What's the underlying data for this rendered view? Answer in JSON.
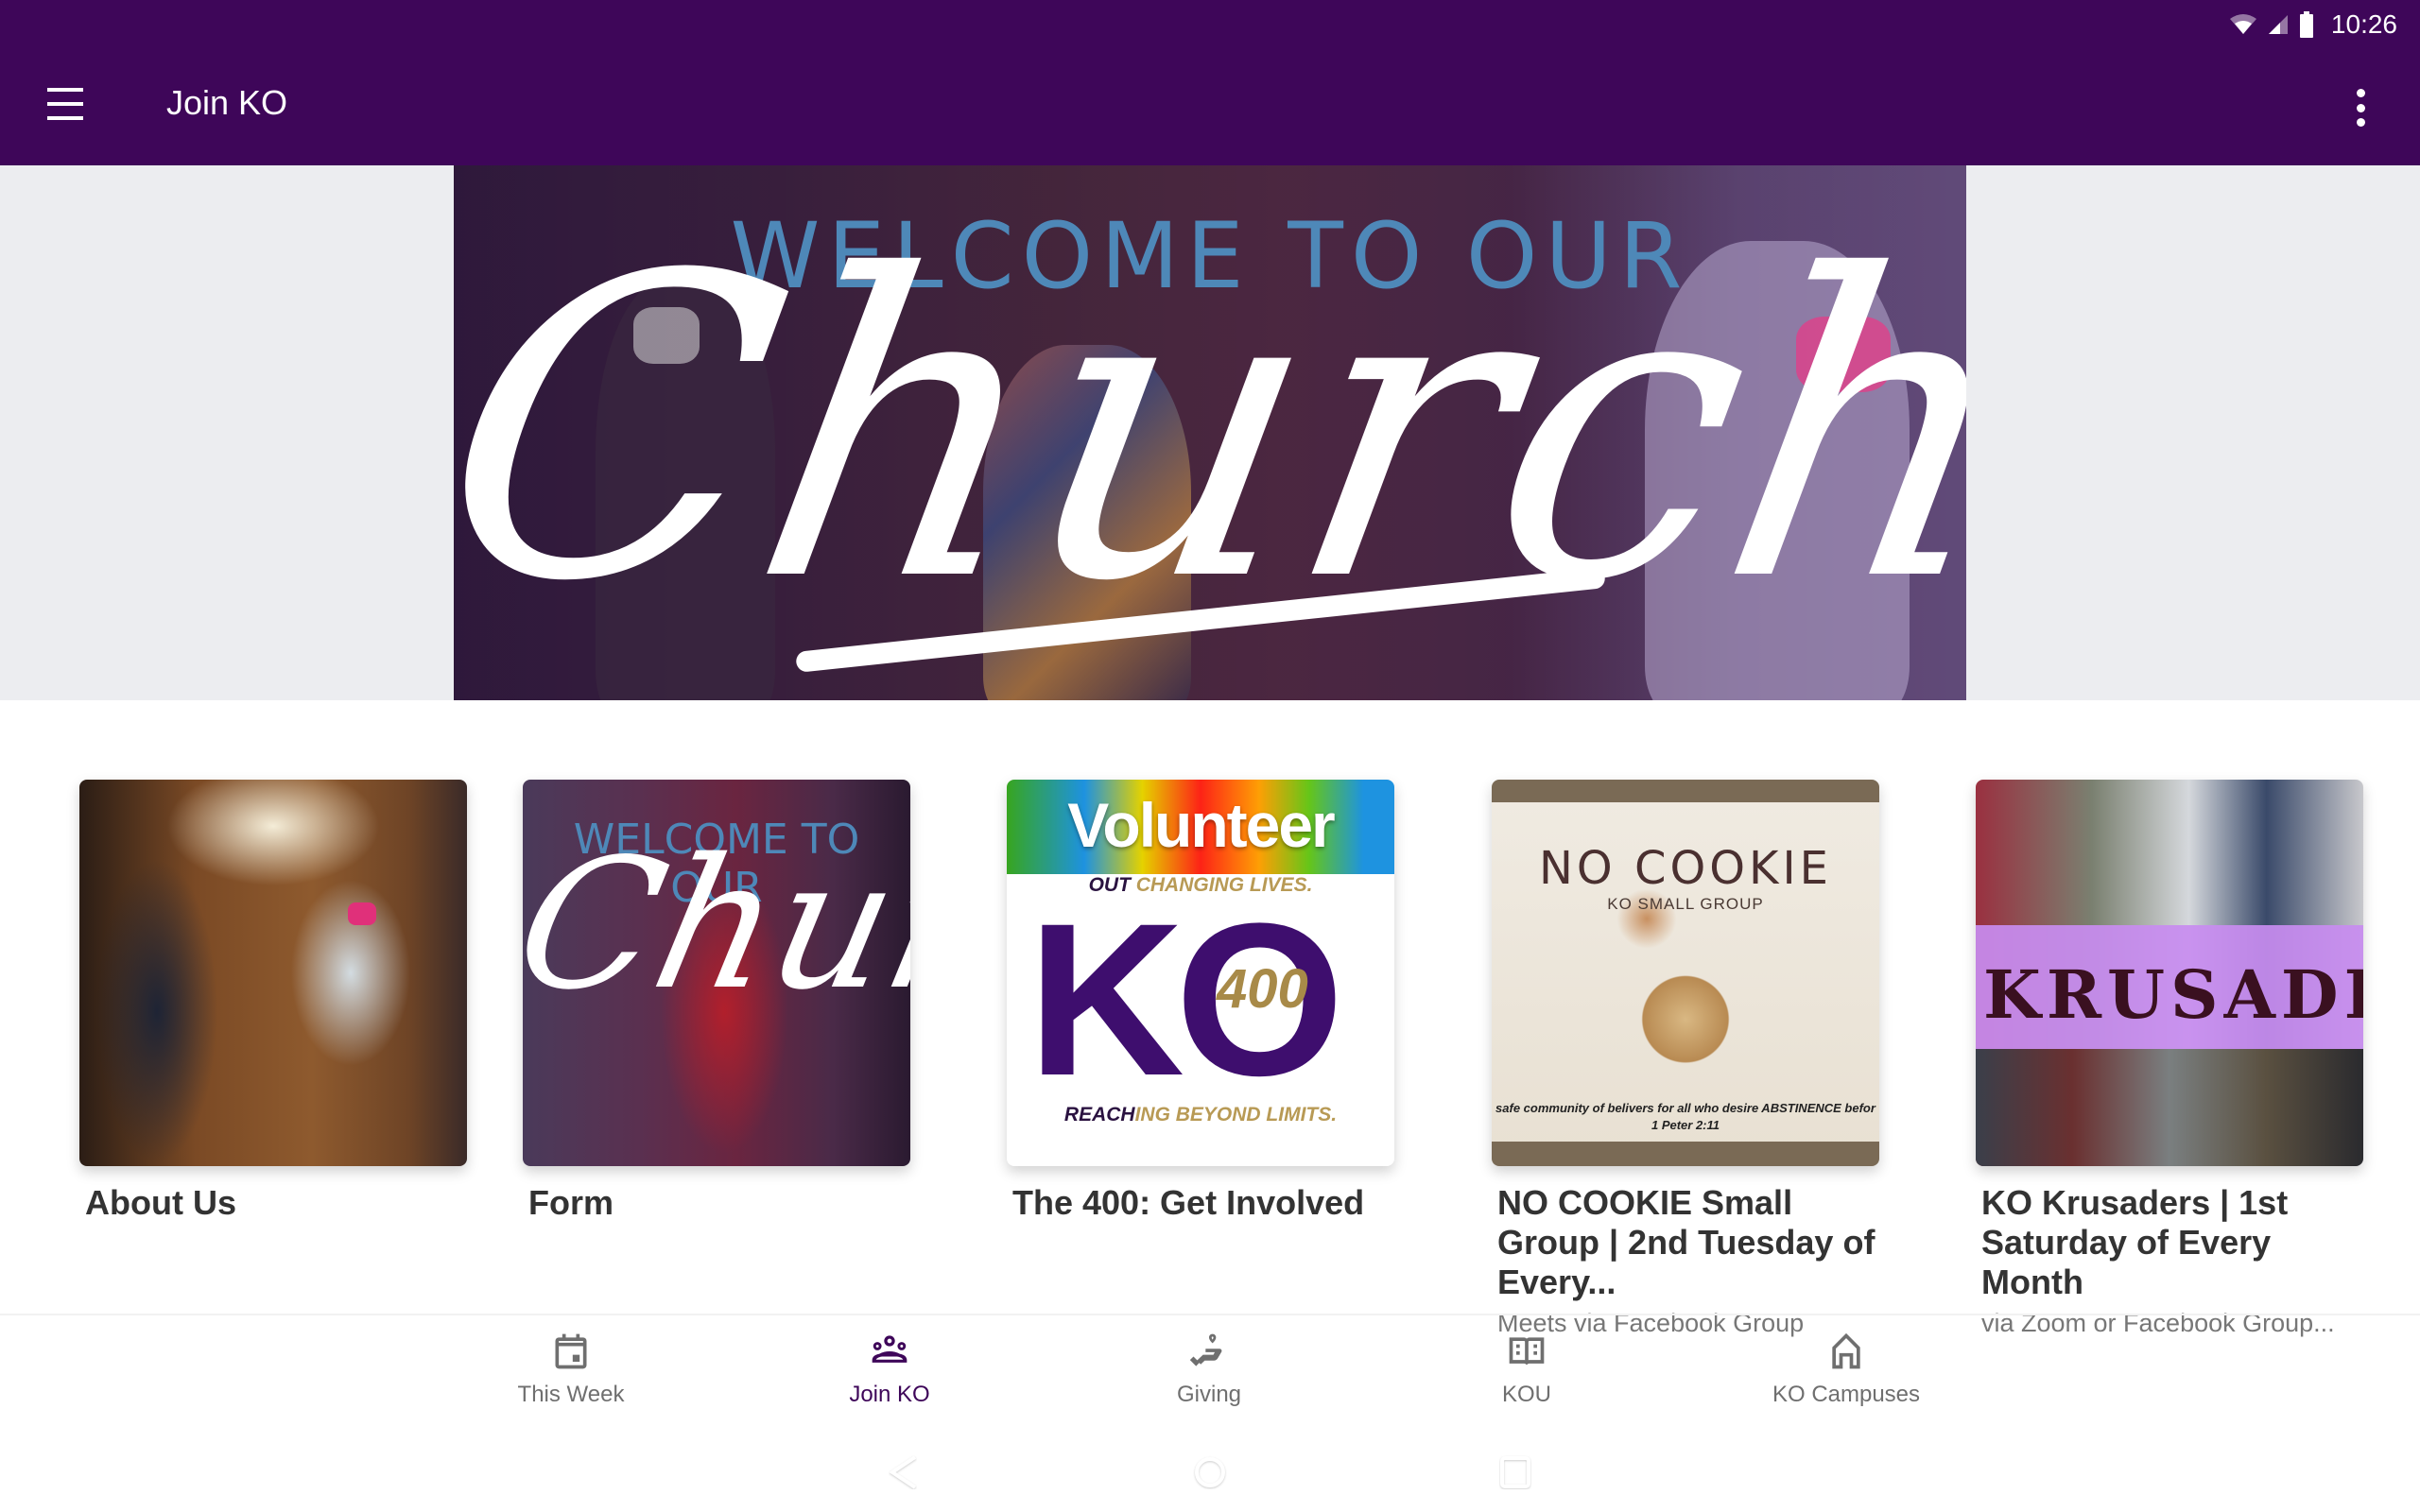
{
  "status_bar": {
    "time": "10:26",
    "icons": [
      "wifi-icon",
      "cell-signal-icon",
      "battery-icon"
    ]
  },
  "app_bar": {
    "title": "Join KO",
    "menu_icon": "hamburger-menu-icon",
    "overflow_icon": "more-vertical-icon",
    "background_color": "#3E0659"
  },
  "hero": {
    "alt": "Welcome to our Church banner",
    "welcome_text": "WELCOME TO OUR",
    "script_text": "Church"
  },
  "cards": [
    {
      "title": "About Us",
      "subtitle": "",
      "image": "About Us photo - worship dancers with flags"
    },
    {
      "title": "Form",
      "subtitle": "",
      "image": "Welcome to our Church graphic",
      "image_text": {
        "welcome": "WELCOME TO OUR",
        "script": "Church"
      }
    },
    {
      "title": "The 400: Get Involved",
      "subtitle": "",
      "image": "Volunteer KO 400 graphic",
      "image_text": {
        "headline": "Volunteer",
        "line1_dark": "OUT",
        "line1_gold": " CHANGING LIVES.",
        "logo": "KO",
        "number": "400",
        "line3_dark": "REACH",
        "line3_gold": "ING BEYOND LIMITS."
      }
    },
    {
      "title": "NO COOKIE Small Group | 2nd Tuesday of Every...",
      "subtitle": "Meets via Facebook Group",
      "image": "No Cookie KO Small Group baking graphic",
      "image_text": {
        "headline": "NO COOKIE",
        "sub": "KO SMALL GROUP",
        "quote": "safe community of belivers for all who desire ABSTINENCE befor",
        "verse": "1 Peter 2:11"
      }
    },
    {
      "title": "KO Krusaders | 1st Saturday of Every Month",
      "subtitle": "via Zoom or Facebook Group...",
      "image": "KO Krusaders collage",
      "image_text": {
        "headline": "KRUSADE"
      }
    }
  ],
  "bottom_nav": {
    "items": [
      {
        "label": "This Week",
        "icon": "calendar-icon",
        "active": false
      },
      {
        "label": "Join KO",
        "icon": "groups-icon",
        "active": true
      },
      {
        "label": "Giving",
        "icon": "volunteer-heart-hand-icon",
        "active": false
      },
      {
        "label": "KOU",
        "icon": "open-book-icon",
        "active": false
      },
      {
        "label": "KO Campuses",
        "icon": "home-icon",
        "active": false
      }
    ],
    "active_color": "#3E0659",
    "inactive_color": "#6F6F6F"
  },
  "system_nav": {
    "buttons": [
      "back-icon",
      "home-circle-icon",
      "recents-icon"
    ]
  }
}
